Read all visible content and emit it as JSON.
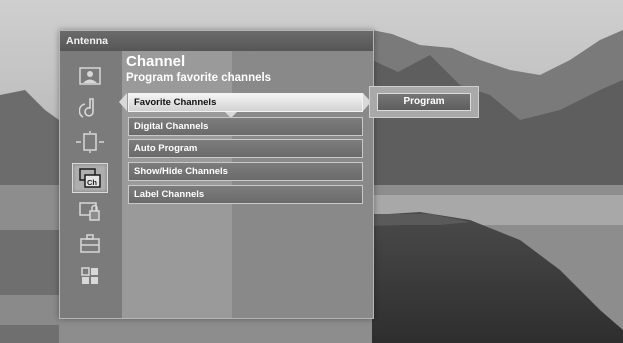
{
  "window": {
    "title": "Antenna"
  },
  "header": {
    "title": "Channel",
    "subtitle": "Program favorite channels"
  },
  "sidebar": {
    "icons": [
      {
        "name": "picture-icon"
      },
      {
        "name": "sound-icon"
      },
      {
        "name": "screen-icon"
      },
      {
        "name": "channel-icon",
        "selected": true
      },
      {
        "name": "lock-icon"
      },
      {
        "name": "setup-icon"
      },
      {
        "name": "applications-icon"
      }
    ]
  },
  "menu": {
    "items": [
      {
        "label": "Favorite Channels",
        "selected": true
      },
      {
        "label": "Digital Channels"
      },
      {
        "label": "Auto Program"
      },
      {
        "label": "Show/Hide Channels"
      },
      {
        "label": "Label Channels"
      }
    ]
  },
  "submenu": {
    "program_label": "Program"
  }
}
